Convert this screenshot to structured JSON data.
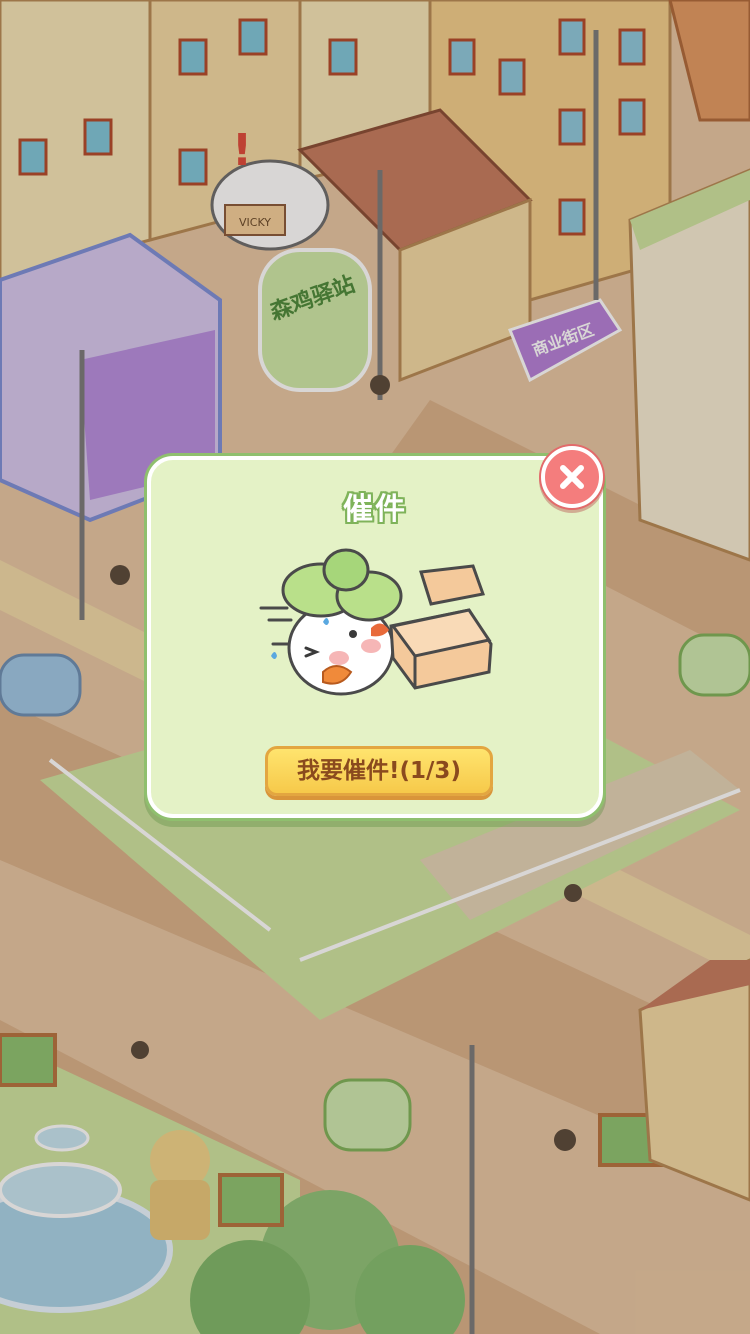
{
  "scene": {
    "store_sign": "森鸡驿站",
    "district_sign": "商业街区",
    "parcel_label": "VICKY",
    "colors": {
      "road": "#e7c6a3",
      "grass": "#cfe4a0",
      "building_cream": "#f6e6b8",
      "roof_orange": "#f3b46a"
    }
  },
  "dialog": {
    "title": "催件",
    "action_label": "我要催件!(1/3)",
    "close_icon": "close-icon",
    "illustration_icon": "chick-with-parcels-icon",
    "colors": {
      "panel": "#e4f2c6",
      "border": "#8fbf6e",
      "button": "#f6c94a",
      "close": "#f47d7d"
    }
  }
}
